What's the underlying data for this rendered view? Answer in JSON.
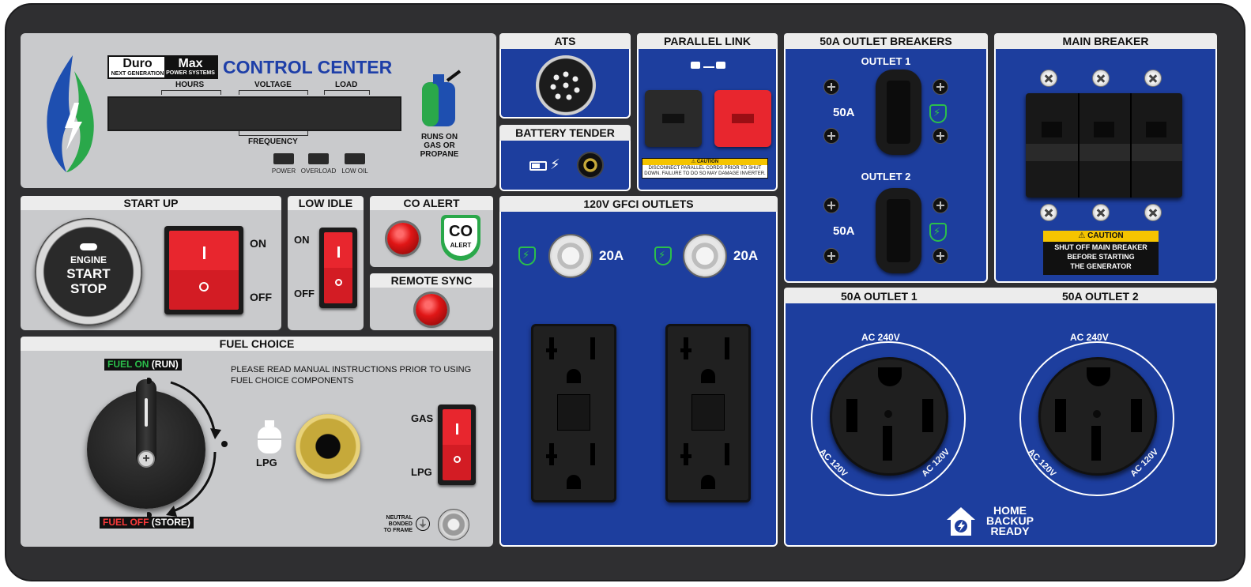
{
  "brand": {
    "duro": "Duro",
    "max": "Max",
    "sub_left": "NEXT GENERATION",
    "sub_right": "POWER SYSTEMS",
    "title": "CONTROL CENTER"
  },
  "display": {
    "hours": "HOURS",
    "voltage": "VOLTAGE",
    "load": "LOAD",
    "frequency": "FREQUENCY",
    "indicators": [
      "POWER",
      "OVERLOAD",
      "LOW OIL"
    ]
  },
  "fuel_badge": {
    "l1": "RUNS ON",
    "l2": "GAS OR",
    "l3": "PROPANE"
  },
  "startup": {
    "title": "START UP",
    "engine": "ENGINE",
    "start": "START",
    "stop": "STOP",
    "on": "ON",
    "off": "OFF"
  },
  "low_idle": {
    "title": "LOW IDLE",
    "on": "ON",
    "off": "OFF"
  },
  "co_alert": {
    "title": "CO ALERT",
    "badge_big": "CO",
    "badge_small": "ALERT"
  },
  "remote_sync": {
    "title": "REMOTE SYNC"
  },
  "fuel_choice": {
    "title": "FUEL CHOICE",
    "fuel_on": "FUEL ON",
    "run": "(RUN)",
    "fuel_off": "FUEL OFF",
    "store": "(STORE)",
    "notice_1": "PLEASE READ MANUAL INSTRUCTIONS PRIOR TO USING",
    "notice_2": "FUEL CHOICE COMPONENTS",
    "lpg_tank": "LPG",
    "gas": "GAS",
    "lpg": "LPG",
    "neutral_1": "NEUTRAL",
    "neutral_2": "BONDED",
    "neutral_3": "TO FRAME"
  },
  "ats": {
    "title": "ATS"
  },
  "battery": {
    "title": "BATTERY TENDER"
  },
  "parallel": {
    "title": "PARALLEL LINK",
    "caution": "CAUTION",
    "caution_1": "DISCONNECT PARALLEL CORDS PRIOR TO SHUT",
    "caution_2": "DOWN. FAILURE TO DO SO MAY DAMAGE INVERTER."
  },
  "gfci": {
    "title": "120V GFCI OUTLETS",
    "left_amp": "20A",
    "right_amp": "20A"
  },
  "breakers50": {
    "title": "50A OUTLET BREAKERS",
    "outlet1": "OUTLET 1",
    "outlet2": "OUTLET 2",
    "amp1": "50A",
    "amp2": "50A"
  },
  "main_breaker": {
    "title": "MAIN BREAKER",
    "caution": "CAUTION",
    "l1": "SHUT OFF MAIN BREAKER",
    "l2": "BEFORE STARTING",
    "l3": "THE GENERATOR"
  },
  "outlets50": {
    "o1": "50A OUTLET 1",
    "o2": "50A OUTLET 2",
    "ac240": "AC 240V",
    "ac120": "AC 120V",
    "home_1": "HOME",
    "home_2": "BACKUP",
    "home_3": "READY"
  },
  "colors": {
    "panel_blue": "#1d3e9e",
    "frame": "#2f2f31",
    "panel_gray": "#c9cacc",
    "switch_red": "#e8262e",
    "caution_yellow": "#f5c400",
    "shield_green": "#2bbf4b"
  }
}
